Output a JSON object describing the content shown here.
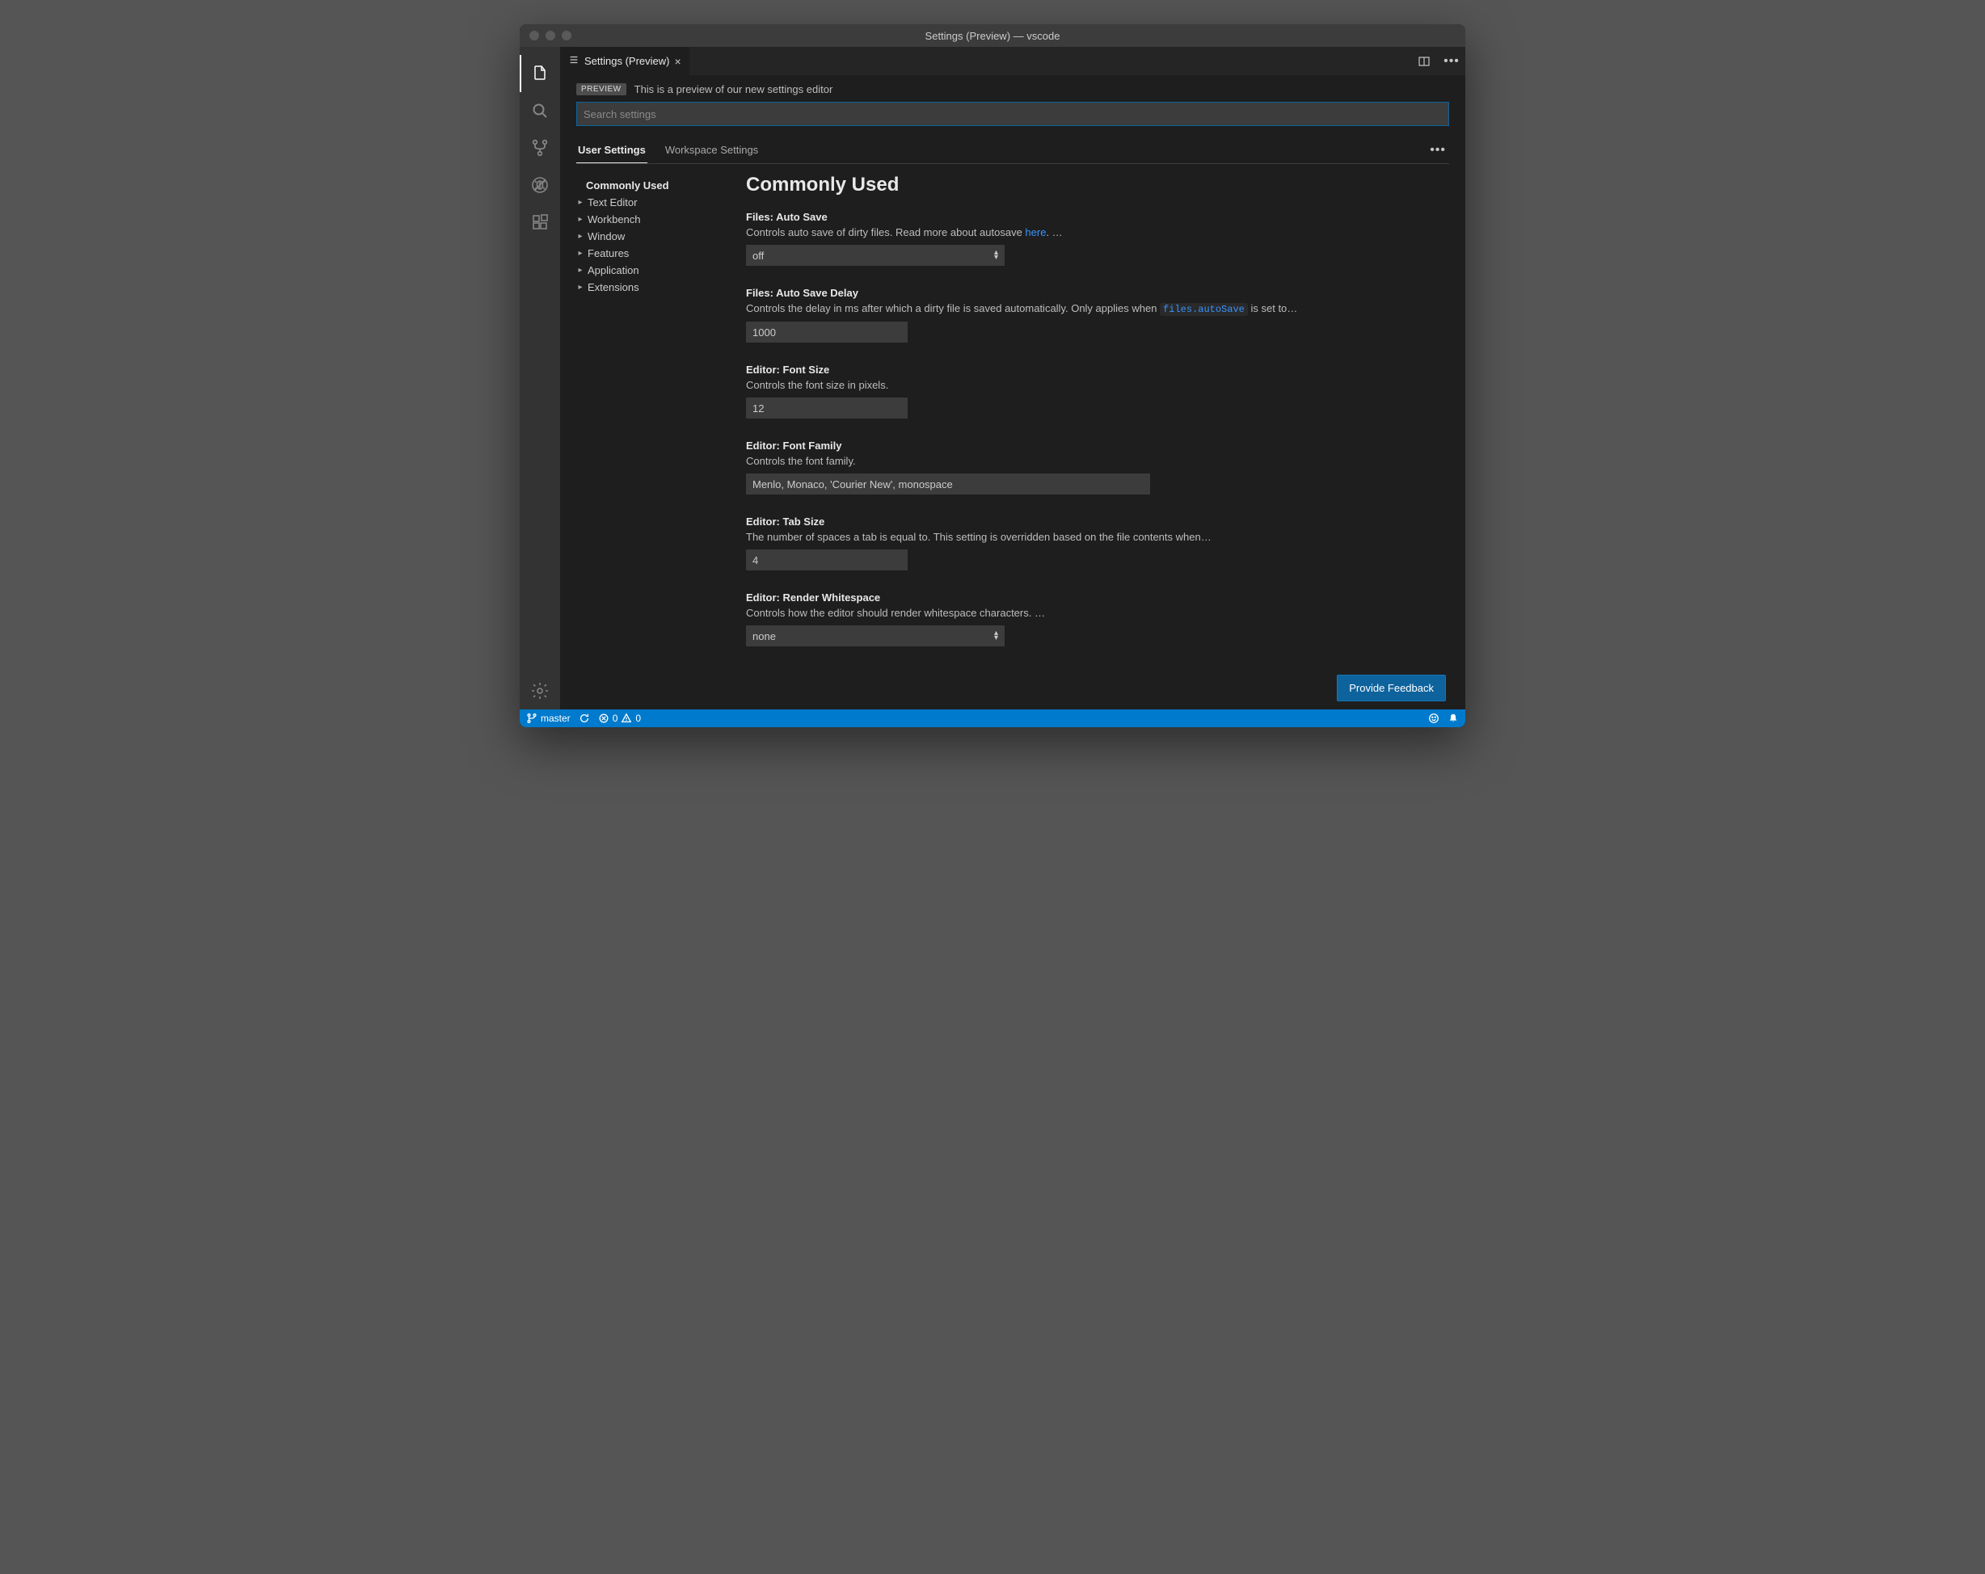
{
  "window": {
    "title": "Settings (Preview) — vscode"
  },
  "tab": {
    "title": "Settings (Preview)"
  },
  "preview": {
    "badge": "PREVIEW",
    "text": "This is a preview of our new settings editor"
  },
  "search": {
    "placeholder": "Search settings"
  },
  "scope": {
    "user": "User Settings",
    "workspace": "Workspace Settings"
  },
  "toc": {
    "commonly_used": "Commonly Used",
    "items": [
      "Text Editor",
      "Workbench",
      "Window",
      "Features",
      "Application",
      "Extensions"
    ]
  },
  "section": {
    "title": "Commonly Used"
  },
  "settings": {
    "auto_save": {
      "label_cat": "Files:",
      "label_name": "Auto Save",
      "desc_pre": "Controls auto save of dirty files. Read more about autosave ",
      "desc_link": "here",
      "desc_post": ". …",
      "value": "off"
    },
    "auto_save_delay": {
      "label_cat": "Files:",
      "label_name": "Auto Save Delay",
      "desc_pre": "Controls the delay in ms after which a dirty file is saved automatically. Only applies when ",
      "desc_code": "files.autoSave",
      "desc_post": " is set to…",
      "value": "1000"
    },
    "font_size": {
      "label_cat": "Editor:",
      "label_name": "Font Size",
      "desc": "Controls the font size in pixels.",
      "value": "12"
    },
    "font_family": {
      "label_cat": "Editor:",
      "label_name": "Font Family",
      "desc": "Controls the font family.",
      "value": "Menlo, Monaco, 'Courier New', monospace"
    },
    "tab_size": {
      "label_cat": "Editor:",
      "label_name": "Tab Size",
      "desc": "The number of spaces a tab is equal to. This setting is overridden based on the file contents when…",
      "value": "4"
    },
    "render_whitespace": {
      "label_cat": "Editor:",
      "label_name": "Render Whitespace",
      "desc": "Controls how the editor should render whitespace characters. …",
      "value": "none"
    }
  },
  "feedback": {
    "label": "Provide Feedback"
  },
  "status": {
    "branch": "master",
    "errors": "0",
    "warnings": "0"
  }
}
